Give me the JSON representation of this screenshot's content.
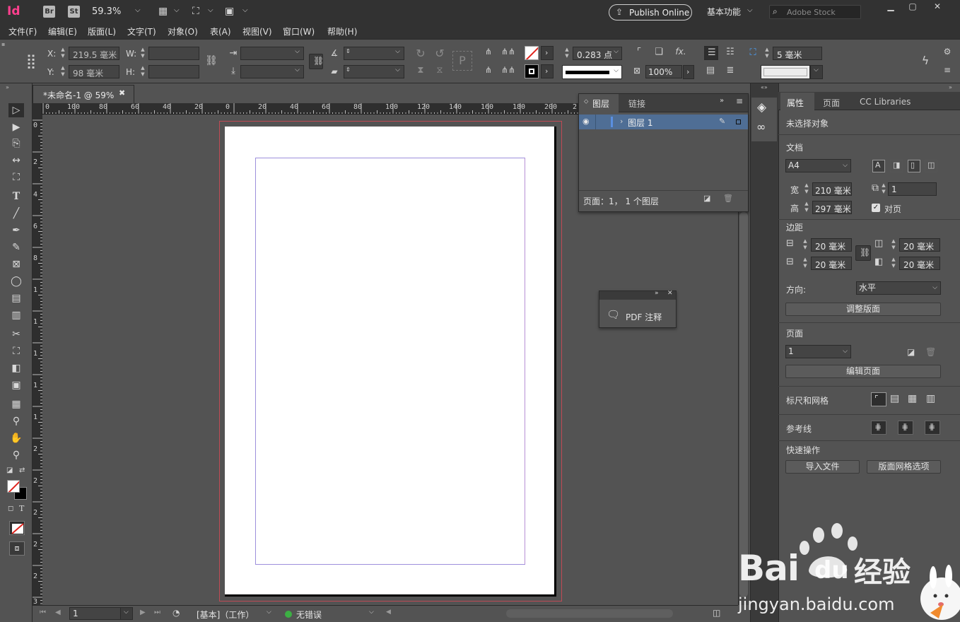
{
  "app_bar": {
    "logo": "Id",
    "bridge": "Br",
    "stock_app": "St",
    "zoom": "59.3%",
    "publish": "Publish Online",
    "workspace": "基本功能",
    "search_placeholder": "Adobe Stock"
  },
  "menu": [
    "文件(F)",
    "编辑(E)",
    "版面(L)",
    "文字(T)",
    "对象(O)",
    "表(A)",
    "视图(V)",
    "窗口(W)",
    "帮助(H)"
  ],
  "control": {
    "x_label": "X:",
    "x_value": "219.5 毫米",
    "y_label": "Y:",
    "y_value": "98 毫米",
    "w_label": "W:",
    "h_label": "H:",
    "stroke_weight": "0.283 点",
    "opacity": "100%",
    "offset": "5 毫米"
  },
  "document": {
    "tab_title": "*未命名-1 @ 59%",
    "ruler_h": [
      "0",
      "100",
      "80",
      "60",
      "40",
      "20",
      "0",
      "20",
      "40",
      "60",
      "80",
      "100",
      "120",
      "140",
      "160",
      "180",
      "200",
      "2"
    ],
    "ruler_v": [
      "0",
      "2",
      "4",
      "6",
      "8",
      "1",
      "1",
      "1",
      "1",
      "1",
      "2",
      "2",
      "2",
      "2",
      "2",
      "3"
    ]
  },
  "status": {
    "page": "1",
    "master": "[基本]（工作）",
    "preflight": "无错误"
  },
  "layers_panel": {
    "tab_layers": "图层",
    "tab_links": "链接",
    "layer_name": "图层 1",
    "footer": "页面：1，  1 个图层"
  },
  "pdf_panel": {
    "label": "PDF 注释"
  },
  "properties": {
    "tabs": [
      "属性",
      "页面",
      "CC Libraries"
    ],
    "no_selection": "未选择对象",
    "document_section": "文档",
    "page_size": "A4",
    "width_label": "宽",
    "width": "210 毫米",
    "height_label": "高",
    "height": "297 毫米",
    "pages_count": "1",
    "facing_pages": "对页",
    "margins_section": "边距",
    "margin_top": "20 毫米",
    "margin_bottom": "20 毫米",
    "margin_inside": "20 毫米",
    "margin_outside": "20 毫米",
    "orientation_label": "方向:",
    "orientation_value": "水平",
    "adjust_layout": "调整版面",
    "pages_section": "页面",
    "page_select": "1",
    "edit_page": "编辑页面",
    "rulers_grids": "标尺和网格",
    "guides": "参考线",
    "quick_actions": "快速操作",
    "import_file": "导入文件",
    "layout_grid_options": "版面网格选项"
  },
  "watermark": {
    "brand": "Bai",
    "brand2": "du",
    "brand3": "经验",
    "url": "jingyan.baidu.com"
  },
  "colors": {
    "accent_logo": "#ff3f8e",
    "layer_highlight": "#4f6e95",
    "preflight_ok": "#3cb043"
  }
}
